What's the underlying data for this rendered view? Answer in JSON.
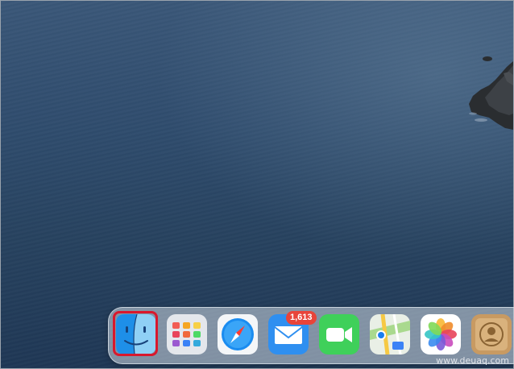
{
  "desktop": {
    "wallpaper": "ocean-coastline"
  },
  "dock": {
    "apps": [
      {
        "name": "Finder",
        "icon": "finder-icon",
        "selected": true
      },
      {
        "name": "Launchpad",
        "icon": "launchpad-icon"
      },
      {
        "name": "Safari",
        "icon": "safari-icon"
      },
      {
        "name": "Mail",
        "icon": "mail-icon",
        "badge": "1,613"
      },
      {
        "name": "FaceTime",
        "icon": "facetime-icon"
      },
      {
        "name": "Maps",
        "icon": "maps-icon"
      },
      {
        "name": "Photos",
        "icon": "photos-icon"
      },
      {
        "name": "Contacts",
        "icon": "contacts-icon"
      }
    ],
    "highlight_color": "#d9182d"
  },
  "watermark": "www.deuaq.com"
}
